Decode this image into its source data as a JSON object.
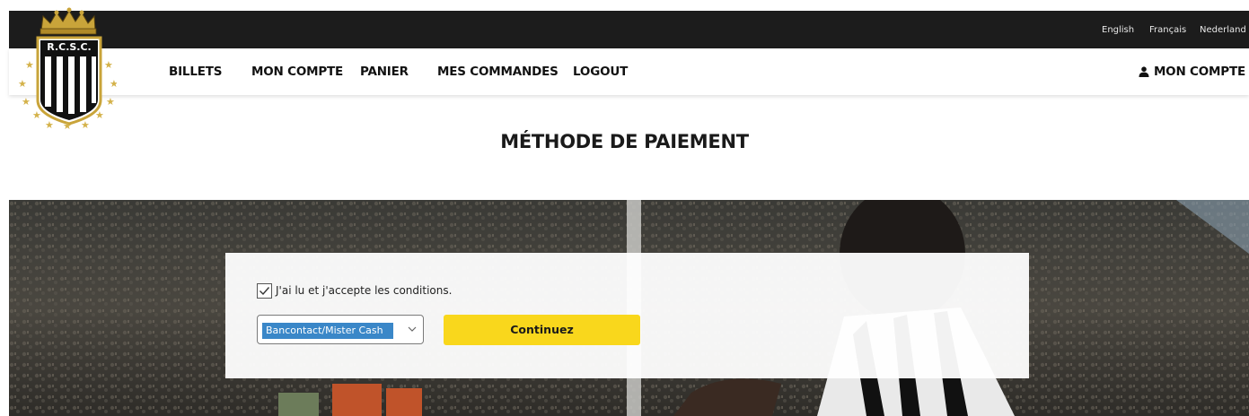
{
  "languages": [
    "English",
    "Français",
    "Nederland"
  ],
  "logo": {
    "text": "R.C.S.C."
  },
  "nav": {
    "items": [
      "BILLETS",
      "MON COMPTE",
      "PANIER",
      "MES COMMANDES",
      "LOGOUT"
    ],
    "account_label": "MON COMPTE",
    "account_icon": "user-icon"
  },
  "page": {
    "title": "MÉTHODE DE PAIEMENT"
  },
  "payment_form": {
    "terms_label": "J'ai lu et j'accepte les conditions.",
    "terms_checked": true,
    "method_selected": "Bancontact/Mister Cash",
    "continue_label": "Continuez"
  },
  "colors": {
    "topbar": "#1c1c1c",
    "accent": "#f9d71c",
    "select_highlight": "#3a87c8"
  }
}
